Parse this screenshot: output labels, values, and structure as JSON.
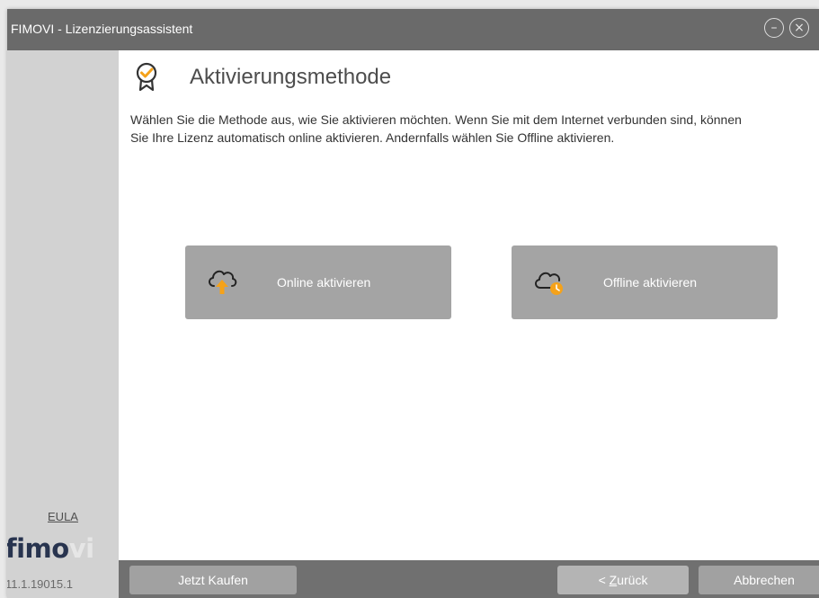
{
  "window": {
    "title": "FIMOVI - Lizenzierungsassistent",
    "controls": {
      "minimize_icon": "minimize-circle-icon",
      "close_icon": "close-circle-icon"
    }
  },
  "sidebar": {
    "eula_label": "EULA",
    "logo_dark": "fimo",
    "logo_light": "vi",
    "version": "11.1.19015.1"
  },
  "main": {
    "icon": "badge-check-icon",
    "heading": "Aktivierungsmethode",
    "description": "Wählen Sie die Methode aus, wie Sie aktivieren möchten. Wenn Sie mit dem Internet verbunden sind, können Sie Ihre Lizenz automatisch online aktivieren. Andernfalls wählen Sie Offline aktivieren.",
    "options": [
      {
        "label": "Online aktivieren",
        "icon": "cloud-upload-icon"
      },
      {
        "label": "Offline aktivieren",
        "icon": "cloud-clock-icon"
      }
    ]
  },
  "footer": {
    "buy_label": "Jetzt Kaufen",
    "back_prefix": "< ",
    "back_mnemonic": "Z",
    "back_rest": "urück",
    "cancel_label": "Abbrechen"
  },
  "colors": {
    "accent": "#f5a21a",
    "titlebar": "#6a6a6a",
    "sidebar": "#d2d2d2",
    "button": "#a4a4a4",
    "footer": "#707070"
  }
}
